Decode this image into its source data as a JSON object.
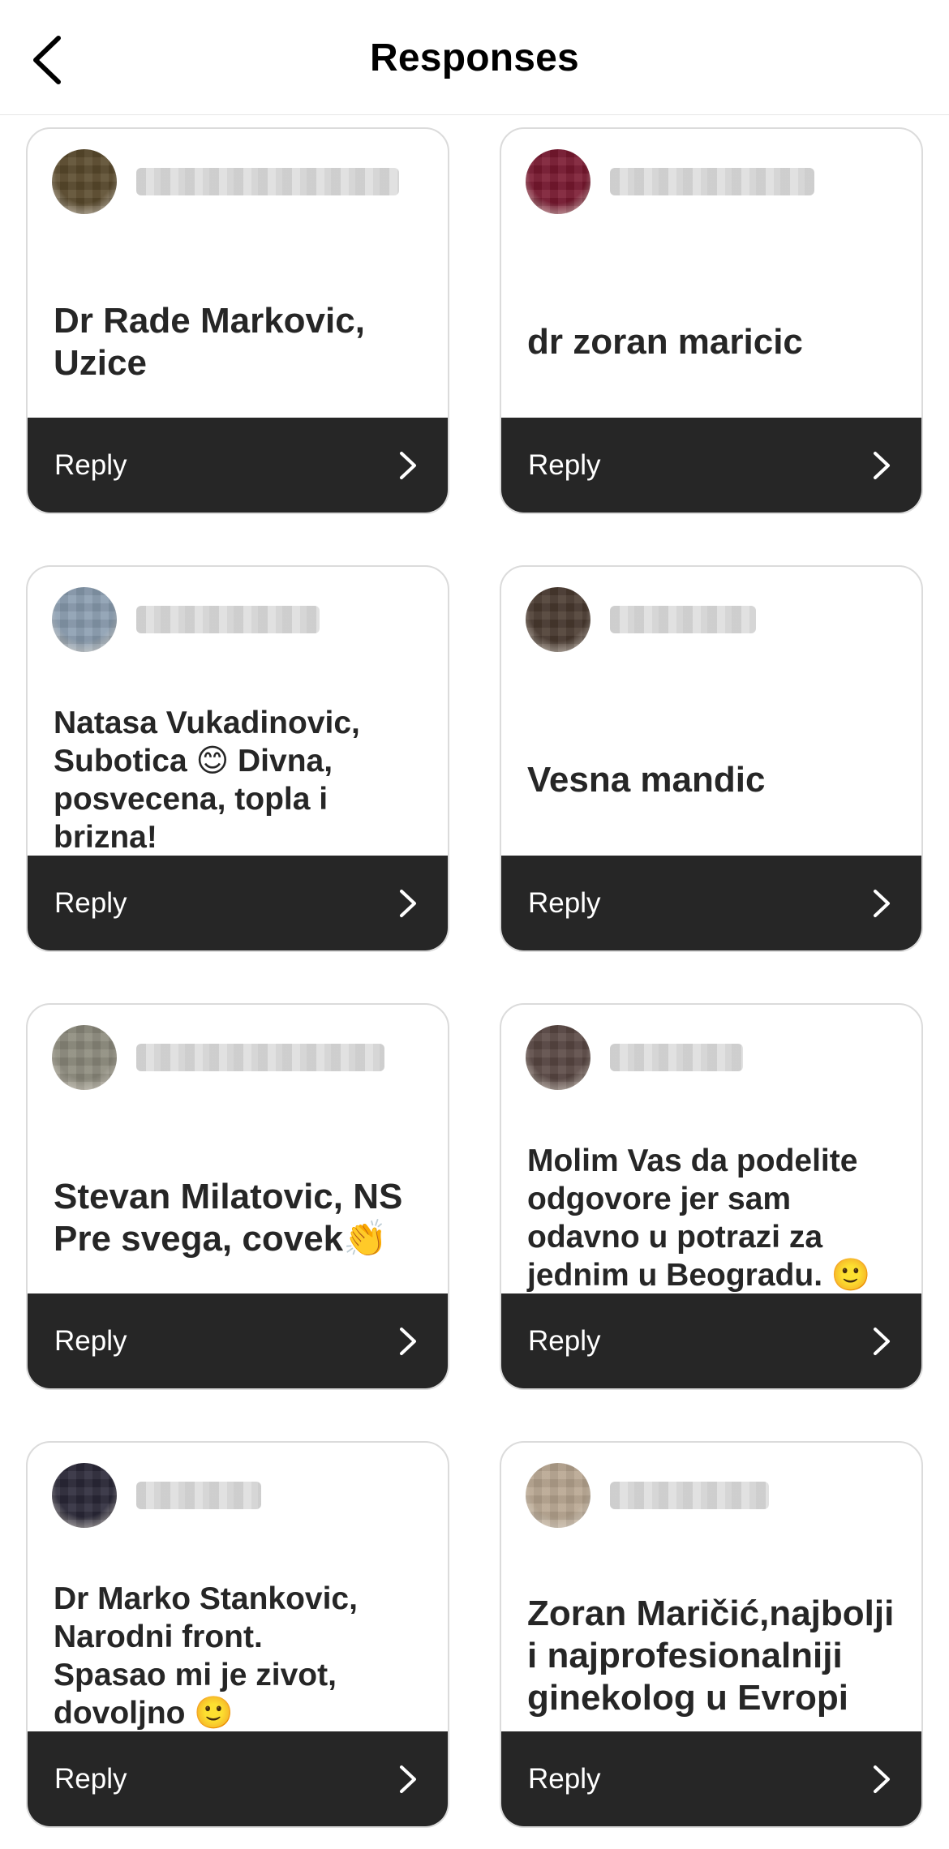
{
  "header": {
    "title": "Responses",
    "back_icon": "chevron-left-icon"
  },
  "responses": [
    {
      "avatar_color": "#5a4a2c",
      "text": "Dr Rade Markovic,\nUzice",
      "reply_label": "Reply"
    },
    {
      "avatar_color": "#7a1830",
      "text": "dr zoran maricic",
      "reply_label": "Reply"
    },
    {
      "avatar_color": "#8a9db0",
      "text": "Natasa Vukadinovic,\nSubotica 😊 Divna,\nposvecena, topla i\nbrizna!",
      "reply_label": "Reply"
    },
    {
      "avatar_color": "#4a3a30",
      "text": "Vesna mandic",
      "reply_label": "Reply"
    },
    {
      "avatar_color": "#8c8a7c",
      "text": "Stevan Milatovic, NS\nPre svega, covek👏",
      "reply_label": "Reply"
    },
    {
      "avatar_color": "#5a4844",
      "text": "Molim Vas da podelite\nodgovore jer sam\nodavno u potrazi za\njednim u Beogradu. 🙂",
      "reply_label": "Reply"
    },
    {
      "avatar_color": "#2a2838",
      "text": "Dr Marko Stankovic,\nNarodni front.\nSpasao mi je zivot,\ndovoljno 🙂",
      "reply_label": "Reply"
    },
    {
      "avatar_color": "#b8a690",
      "text": "Zoran Maričić,najbolji\ni najprofesionalniji\nginekolog u Evropi",
      "reply_label": "Reply"
    }
  ],
  "colors": {
    "reply_bar": "#262626",
    "card_border": "#dbdbdb",
    "text": "#262626"
  },
  "icons": {
    "reply_chevron": "chevron-right-icon"
  }
}
